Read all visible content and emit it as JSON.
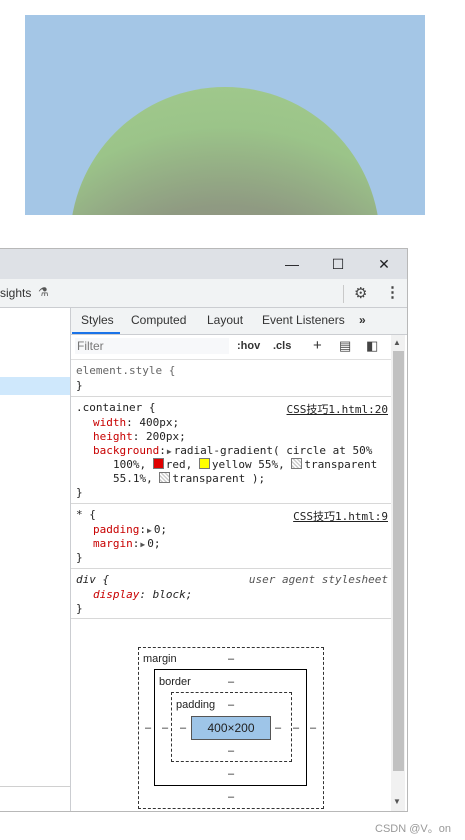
{
  "preview": {
    "background": "#a4c6e6"
  },
  "toolbar": {
    "insights_label": "sights",
    "flask_icon": "flask-icon",
    "settings_icon": "gear-icon",
    "more_icon": "kebab-icon"
  },
  "window": {
    "minimize": "—",
    "maximize": "☐",
    "close": "✕"
  },
  "tabs": [
    "Styles",
    "Computed",
    "Layout",
    "Event Listeners",
    "»"
  ],
  "filter": {
    "placeholder": "Filter",
    "hov": ":hov",
    "cls": ".cls",
    "plus": "+"
  },
  "rules": {
    "element_style": {
      "selector": "element.style {",
      "close": "}"
    },
    "container": {
      "selector": ".container {",
      "source": "CSS技巧1.html:20",
      "width_prop": "width",
      "width_val": "400px;",
      "height_prop": "height",
      "height_val": "200px;",
      "bg_prop": "background",
      "bg_line1": "radial-gradient( circle at 50%",
      "bg_line2_a": "100%,",
      "bg_red": "red,",
      "bg_yellow": "yellow 55%,",
      "bg_transparent": "transparent",
      "bg_line3_a": "55.1%,",
      "bg_line3_b": "transparent );",
      "close": "}",
      "colors": {
        "red": "#e00000",
        "yellow": "#ffff00"
      }
    },
    "star": {
      "selector": "* {",
      "source": "CSS技巧1.html:9",
      "padding_prop": "padding",
      "padding_val": "0;",
      "margin_prop": "margin",
      "margin_val": "0;",
      "close": "}"
    },
    "div": {
      "selector": "div {",
      "source": "user agent stylesheet",
      "display_prop": "display",
      "display_val": "block;",
      "close": "}"
    }
  },
  "box_model": {
    "margin_label": "margin",
    "border_label": "border",
    "padding_label": "padding",
    "content": "400×200",
    "dash": "–"
  },
  "watermark": "CSDN @V。on"
}
